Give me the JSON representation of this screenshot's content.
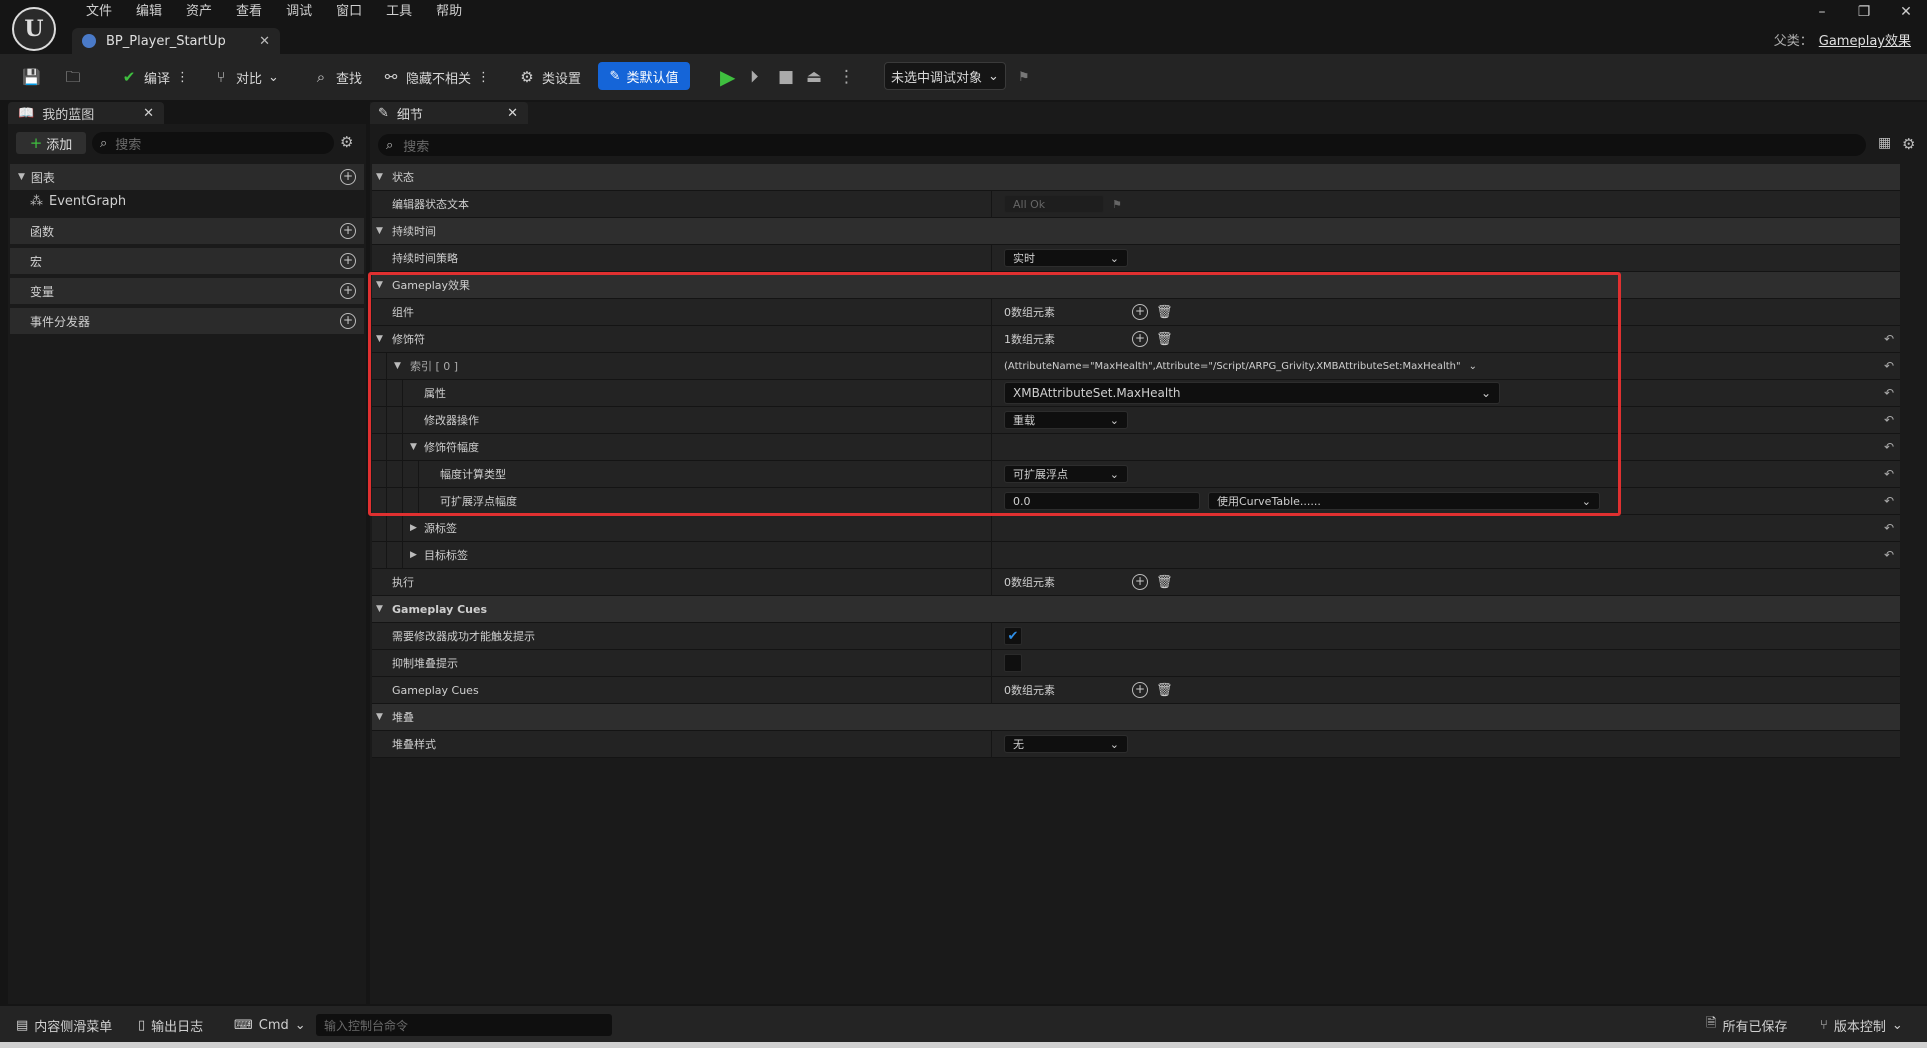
{
  "menu": [
    "文件",
    "编辑",
    "资产",
    "查看",
    "调试",
    "窗口",
    "工具",
    "帮助"
  ],
  "tab": {
    "title": "BP_Player_StartUp"
  },
  "parent": {
    "label": "父类：",
    "value": "Gameplay效果"
  },
  "toolbar": {
    "compile": "编译",
    "diff": "对比",
    "find": "查找",
    "hide_unrelated": "隐藏不相关",
    "class_settings": "类设置",
    "class_defaults": "类默认值",
    "debug_object": "未选中调试对象"
  },
  "my_blueprint": {
    "tab": "我的蓝图",
    "add": "添加",
    "search_placeholder": "搜索",
    "sections": [
      "图表",
      "函数",
      "宏",
      "变量",
      "事件分发器"
    ],
    "event_graph": "EventGraph"
  },
  "details": {
    "tab": "细节",
    "search_placeholder": "搜索",
    "rows": {
      "state": "状态",
      "editor_state_text": "编辑器状态文本",
      "editor_state_value": "All Ok",
      "duration": "持续时间",
      "duration_policy": "持续时间策略",
      "duration_policy_value": "实时",
      "gameplay_effect": "Gameplay效果",
      "components": "组件",
      "components_value": "0数组元素",
      "modifiers": "修饰符",
      "modifiers_value": "1数组元素",
      "index0": "索引 [ 0 ]",
      "index0_value": "(AttributeName=\"MaxHealth\",Attribute=\"/Script/ARPG_Grivity.XMBAttributeSet:MaxHealth\"",
      "attribute": "属性",
      "attribute_value": "XMBAttributeSet.MaxHealth",
      "modifier_op": "修改器操作",
      "modifier_op_value": "重载",
      "modifier_magnitude": "修饰符幅度",
      "magnitude_calc_type": "幅度计算类型",
      "magnitude_calc_type_value": "可扩展浮点",
      "scalable_float": "可扩展浮点幅度",
      "scalable_float_value": "0.0",
      "curve_table": "使用CurveTable......",
      "source_tags": "源标签",
      "target_tags": "目标标签",
      "executions": "执行",
      "executions_value": "0数组元素",
      "gameplay_cues_cat": "Gameplay Cues",
      "require_modifier_success": "需要修改器成功才能触发提示",
      "suppress_stacking_cues": "抑制堆叠提示",
      "gameplay_cues": "Gameplay Cues",
      "gameplay_cues_value": "0数组元素",
      "stacking": "堆叠",
      "stacking_type": "堆叠样式",
      "stacking_type_value": "无"
    }
  },
  "statusbar": {
    "content_drawer": "内容侧滑菜单",
    "output_log": "输出日志",
    "cmd": "Cmd",
    "cmd_placeholder": "输入控制台命令",
    "all_saved": "所有已保存",
    "source_control": "版本控制"
  },
  "colors": {
    "accent": "#1565d8",
    "highlight": "#e03030",
    "play": "#3fbf3f"
  }
}
